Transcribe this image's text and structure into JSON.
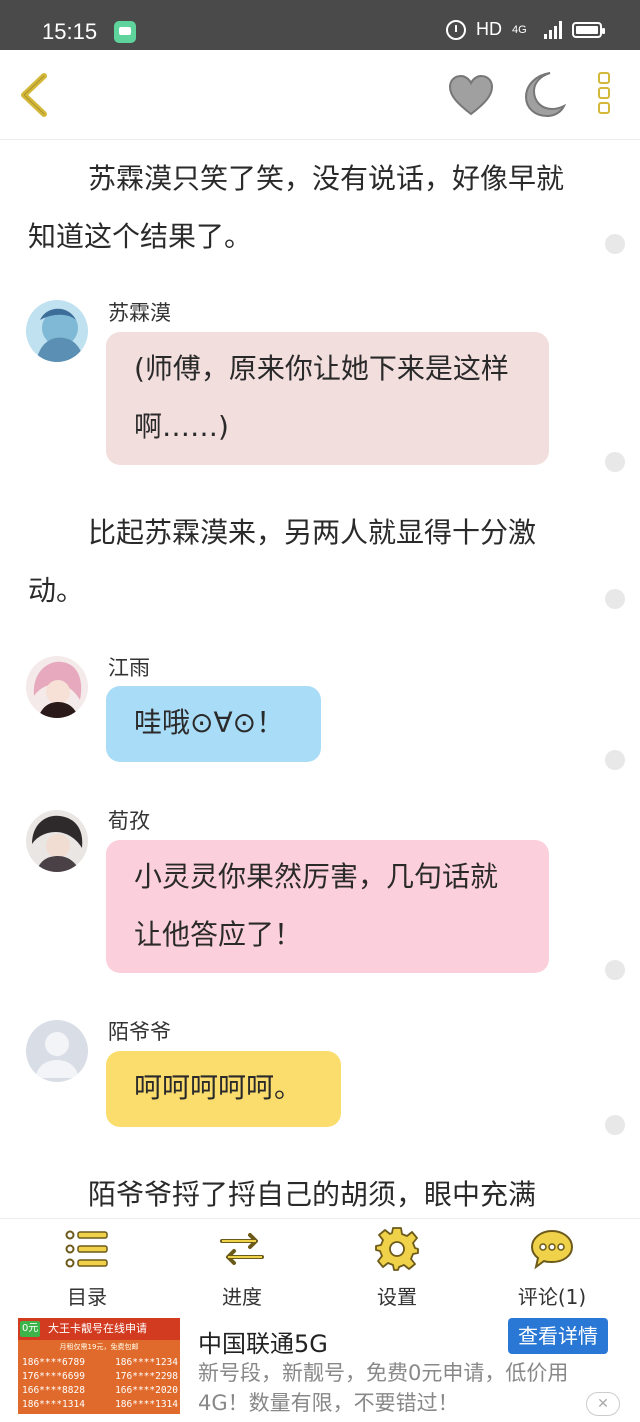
{
  "status_bar": {
    "time": "15:15",
    "network": "HD",
    "signal_label": "4G"
  },
  "top_nav": {
    "icons": [
      "back-icon",
      "heart-icon",
      "moon-icon",
      "more-icon"
    ],
    "accent_color": "#d4b83a",
    "icon_gray": "#9a9a9a"
  },
  "content": {
    "para1": "苏霖漠只笑了笑，没有说话，好像早就知道这个结果了。",
    "chat1": {
      "name": "苏霖漠",
      "text": "(师傅，原来你让她下来是这样啊……)",
      "bubble_color": "#f3dede"
    },
    "para2": "比起苏霖漠来，另两人就显得十分激动。",
    "chat2": {
      "name": "江雨",
      "text": "哇哦⊙∀⊙！",
      "bubble_color": "#a9dcf7"
    },
    "chat3": {
      "name": "荀孜",
      "text": "小灵灵你果然厉害，几句话就让他答应了！",
      "bubble_color": "#fccfdc"
    },
    "chat4": {
      "name": "陌爷爷",
      "text": "呵呵呵呵呵。",
      "bubble_color": "#fbdd6e"
    },
    "para3": "陌爷爷捋了捋自己的胡须，眼中充满"
  },
  "toolbar": {
    "items": [
      {
        "label": "目录",
        "icon": "list-icon"
      },
      {
        "label": "进度",
        "icon": "swap-arrows-icon"
      },
      {
        "label": "设置",
        "icon": "gear-icon"
      },
      {
        "label": "评论(1)",
        "icon": "comment-icon"
      }
    ]
  },
  "ad": {
    "image": {
      "badge": "0元",
      "header": "大王卡靓号在线申请",
      "subheader": "月租仅需19元，免费包邮",
      "numbers": [
        [
          "186****6789",
          "186****1234"
        ],
        [
          "176****6699",
          "176****2298"
        ],
        [
          "166****8828",
          "166****2020"
        ],
        [
          "186****1314",
          "186****1314"
        ]
      ]
    },
    "title": "中国联通5G",
    "button": "查看详情",
    "description": "新号段，新靓号，免费0元申请，低价用4G！数量有限，不要错过！",
    "close": "✕"
  }
}
